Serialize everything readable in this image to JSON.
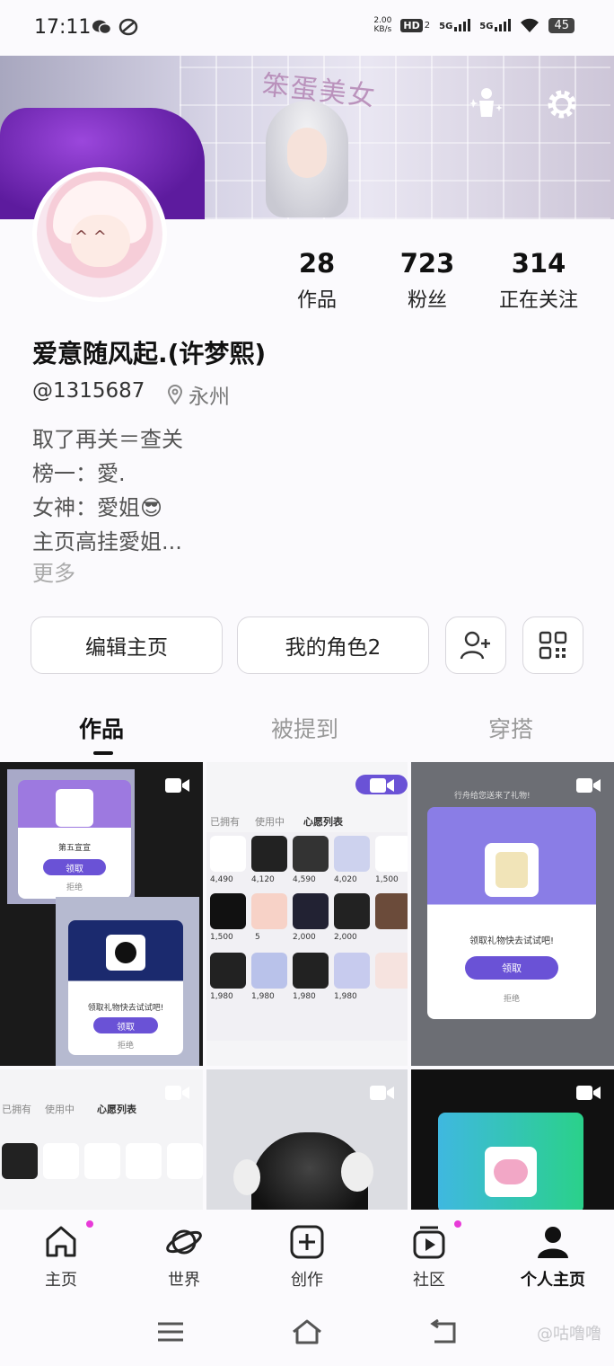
{
  "status_bar": {
    "time": "17:11",
    "net_speed_top": "2.00",
    "net_speed_bottom": "KB/s",
    "hd_label": "HD",
    "hd_sub": "2",
    "signal1": "5G",
    "signal2": "5G",
    "battery": "45"
  },
  "banner": {
    "overlay_text": "笨蛋美女"
  },
  "profile": {
    "stats": [
      {
        "value": "28",
        "label": "作品"
      },
      {
        "value": "723",
        "label": "粉丝"
      },
      {
        "value": "314",
        "label": "正在关注"
      }
    ],
    "nickname": "爱意随风起.(许梦熙)",
    "handle": "@1315687",
    "location": "永州",
    "bio_lines": [
      "取了再关＝查关",
      "榜一：愛.",
      "女神：愛姐😎",
      "主页高挂愛姐..."
    ],
    "more": "更多"
  },
  "actions": {
    "edit": "编辑主页",
    "role": "我的角色2"
  },
  "tabs": [
    "作品",
    "被提到",
    "穿搭"
  ],
  "tiles": {
    "t1": {
      "card1_title": "第五宣宣",
      "card1_btn": "领取",
      "card1_reject": "拒绝",
      "card2_title": "领取礼物快去试试吧!",
      "card2_btn": "领取",
      "card2_reject": "拒绝"
    },
    "t2": {
      "tab_a": "已拥有",
      "tab_b": "使用中",
      "tab_c": "心愿列表",
      "prices": [
        "4,490",
        "4,120",
        "4,590",
        "4,020",
        "1,500",
        "1,500",
        "5",
        "2,000",
        "2,000",
        "1,980",
        "1,980",
        "1,980",
        "1,980"
      ]
    },
    "t3": {
      "header": "行舟给您送来了礼物!",
      "title": "领取礼物快去试试吧!",
      "btn": "领取",
      "reject": "拒绝"
    },
    "t4": {
      "tab_a": "已拥有",
      "tab_b": "使用中",
      "tab_c": "心愿列表"
    }
  },
  "nav": [
    "主页",
    "世界",
    "创作",
    "社区",
    "个人主页"
  ],
  "watermark": "@咕噜噜"
}
